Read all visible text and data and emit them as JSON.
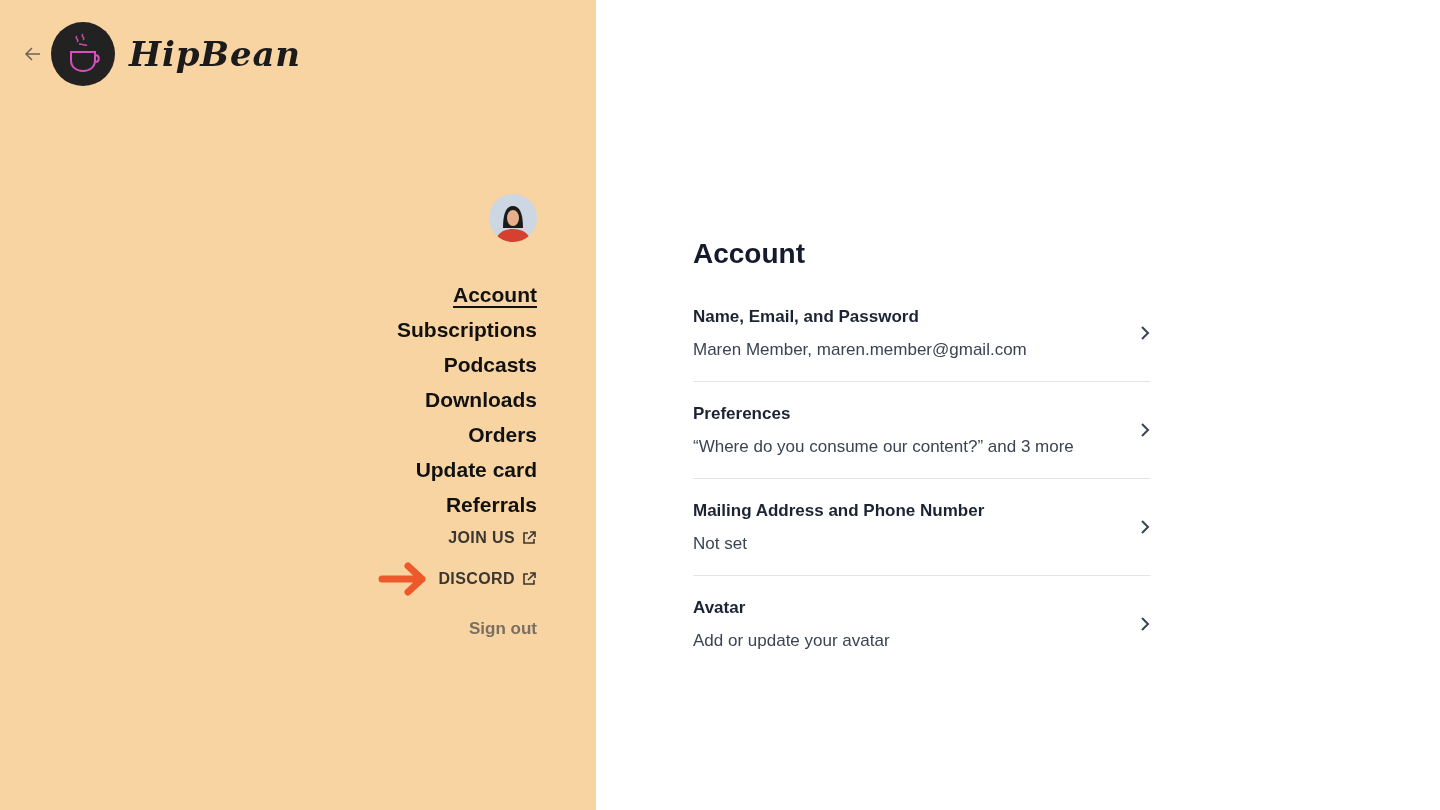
{
  "brand": {
    "name": "HipBean"
  },
  "nav": [
    {
      "label": "Account",
      "selected": true
    },
    {
      "label": "Subscriptions",
      "selected": false
    },
    {
      "label": "Podcasts",
      "selected": false
    },
    {
      "label": "Downloads",
      "selected": false
    },
    {
      "label": "Orders",
      "selected": false
    },
    {
      "label": "Update card",
      "selected": false
    },
    {
      "label": "Referrals",
      "selected": false
    }
  ],
  "external_links": [
    {
      "label": "JOIN US",
      "pointed": false
    },
    {
      "label": "DISCORD",
      "pointed": true
    }
  ],
  "sign_out": "Sign out",
  "main": {
    "title": "Account",
    "rows": [
      {
        "title": "Name, Email, and Password",
        "value": "Maren Member, maren.member@gmail.com"
      },
      {
        "title": "Preferences",
        "value": "“Where do you consume our content?” and 3 more"
      },
      {
        "title": "Mailing Address and Phone Number",
        "value": "Not set"
      },
      {
        "title": "Avatar",
        "value": "Add or update your avatar"
      }
    ]
  }
}
